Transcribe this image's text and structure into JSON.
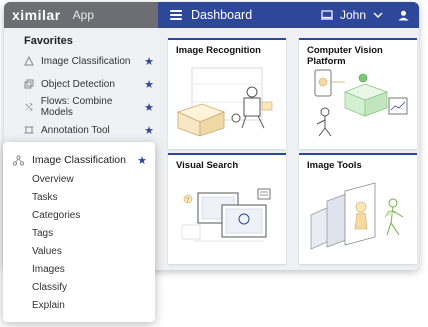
{
  "brand": {
    "logo": "ximilar",
    "app_label": "App"
  },
  "header": {
    "title": "Dashboard",
    "user": "John",
    "screen_icon": "monitor-icon",
    "dropdown_icon": "chevron-down-icon",
    "user_icon": "user-icon"
  },
  "favorites": {
    "heading": "Favorites",
    "items": [
      {
        "label": "Image Classification",
        "icon": "classification-icon"
      },
      {
        "label": "Object Detection",
        "icon": "detection-icon"
      },
      {
        "label": "Flows: Combine Models",
        "icon": "flows-icon"
      },
      {
        "label": "Annotation Tool",
        "icon": "annotation-icon"
      }
    ]
  },
  "cards": [
    {
      "title": "Image Recognition"
    },
    {
      "title": "Computer Vision Platform"
    },
    {
      "title": "Visual Search"
    },
    {
      "title": "Image Tools"
    }
  ],
  "popup": {
    "title": "Image Classification",
    "items": [
      "Overview",
      "Tasks",
      "Categories",
      "Tags",
      "Values",
      "Images",
      "Classify",
      "Explain"
    ]
  },
  "colors": {
    "accent": "#2f4799",
    "brand_bar": "#6d6e73"
  }
}
